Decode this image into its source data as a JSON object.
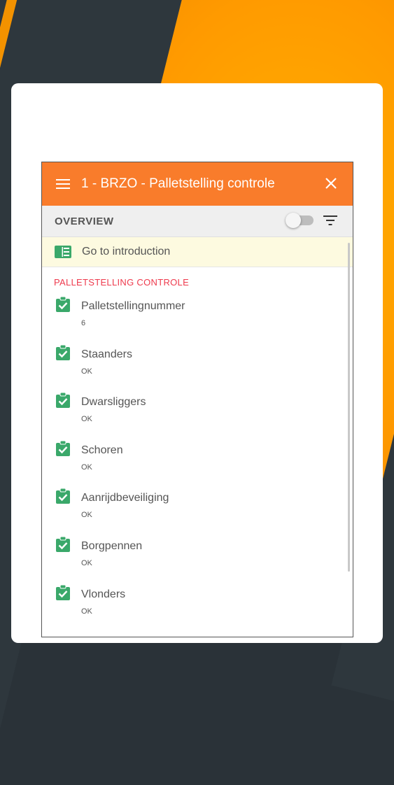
{
  "appbar": {
    "title": "1 - BRZO - Palletstelling controle",
    "menu_icon": "menu-icon",
    "close_icon": "close-icon",
    "color": "#f97c2b"
  },
  "subbar": {
    "overview_label": "OVERVIEW",
    "toggle_on": false,
    "filter_icon": "filter-icon"
  },
  "intro": {
    "label": "Go to introduction",
    "icon": "book-icon"
  },
  "section": {
    "title": "PALLETSTELLING CONTROLE",
    "title_color": "#ee3a4d"
  },
  "items": [
    {
      "label": "Palletstellingnummer",
      "value": "6"
    },
    {
      "label": "Staanders",
      "value": "OK"
    },
    {
      "label": "Dwarsliggers",
      "value": "OK"
    },
    {
      "label": "Schoren",
      "value": "OK"
    },
    {
      "label": "Aanrijdbeveiliging",
      "value": "OK"
    },
    {
      "label": "Borgpennen",
      "value": "OK"
    },
    {
      "label": "Vlonders",
      "value": "OK"
    }
  ],
  "check_color": "#3aa86a"
}
